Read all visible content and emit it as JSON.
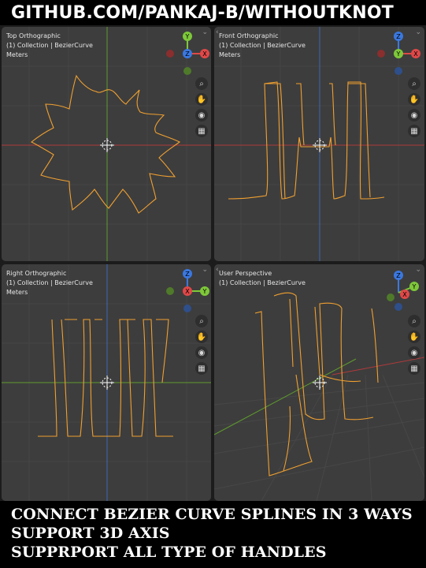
{
  "header": {
    "title": "GITHUB.COM/PANKAJ-B/WITHOUTKNOT"
  },
  "viewports": [
    {
      "name": "Top Orthographic",
      "collection": "(1) Collection | BezierCurve",
      "units": "Meters",
      "gizmo": [
        "Y",
        "X",
        "Z"
      ]
    },
    {
      "name": "Front Orthographic",
      "collection": "(1) Collection | BezierCurve",
      "units": "Meters",
      "gizmo": [
        "Z",
        "X",
        "Y"
      ]
    },
    {
      "name": "Right Orthographic",
      "collection": "(1) Collection | BezierCurve",
      "units": "Meters",
      "gizmo": [
        "Z",
        "Y",
        "X"
      ]
    },
    {
      "name": "User Perspective",
      "collection": "(1) Collection | BezierCurve",
      "units": "",
      "gizmo": [
        "Z",
        "Y",
        "X"
      ]
    }
  ],
  "tools": [
    "zoom-icon",
    "hand-icon",
    "camera-icon",
    "grid-icon"
  ],
  "footer": {
    "line1": "CONNECT BEZIER CURVE SPLINES IN 3 WAYS",
    "line2": "SUPPORT 3D  AXIS",
    "line3": "SUPPRPORT ALL TYPE OF HANDLES"
  },
  "colors": {
    "curve": "#f0a030",
    "x_axis": "#e04848",
    "y_axis": "#7ec83a",
    "z_axis": "#3a78e0",
    "viewport_bg": "#3d3d3d"
  }
}
